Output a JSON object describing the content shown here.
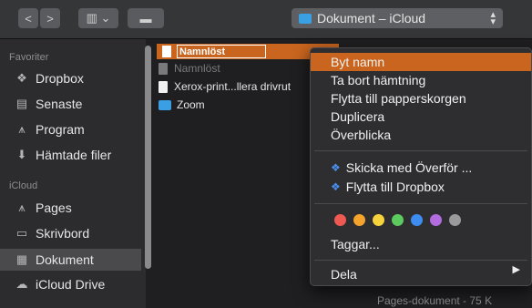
{
  "toolbar": {
    "back": "<",
    "forward": ">",
    "view": "▥ ⌄",
    "folder": "▬",
    "path_label": "Dokument – iCloud"
  },
  "sidebar": {
    "favorites_header": "Favoriter",
    "favorites": [
      {
        "label": "Dropbox",
        "icon": "dropbox-icon"
      },
      {
        "label": "Senaste",
        "icon": "recents-icon"
      },
      {
        "label": "Program",
        "icon": "applications-icon"
      },
      {
        "label": "Hämtade filer",
        "icon": "downloads-icon"
      }
    ],
    "icloud_header": "iCloud",
    "icloud": [
      {
        "label": "Pages",
        "icon": "pages-icon"
      },
      {
        "label": "Skrivbord",
        "icon": "desktop-icon"
      },
      {
        "label": "Dokument",
        "icon": "documents-icon",
        "selected": true
      },
      {
        "label": "iCloud Drive",
        "icon": "icloud-icon"
      }
    ]
  },
  "files": {
    "selected_name": "Namnlöst",
    "items": [
      {
        "label": "Namnlöst",
        "type": "file"
      },
      {
        "label": "Xerox-print...llera drivrut",
        "type": "file"
      },
      {
        "label": "Zoom",
        "type": "folder"
      }
    ]
  },
  "menu": {
    "rename": "Byt namn",
    "remove_download": "Ta bort hämtning",
    "move_trash": "Flytta till papperskorgen",
    "duplicate": "Duplicera",
    "quicklook": "Överblicka",
    "send_transfer": "Skicka med Överför ...",
    "move_dropbox": "Flytta till Dropbox",
    "tags": "Taggar...",
    "share": "Dela"
  },
  "tag_colors": [
    "#ee5a52",
    "#f4a32c",
    "#f6d23c",
    "#5ccb5f",
    "#3d8df0",
    "#b36ce0",
    "#9a9a9c"
  ],
  "preview": {
    "kind_size": "Pages-dokument - 75 K"
  }
}
